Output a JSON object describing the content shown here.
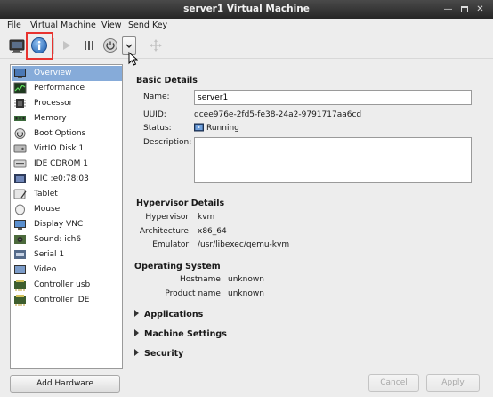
{
  "window": {
    "title": "server1 Virtual Machine"
  },
  "menubar": {
    "file": "File",
    "virtual_machine": "Virtual Machine",
    "view": "View",
    "send_key": "Send Key"
  },
  "toolbar": {
    "buttons": [
      "console-icon",
      "info-icon",
      "run-icon",
      "pause-icon",
      "power-icon",
      "chevron-down-icon",
      "fullscreen-icon"
    ]
  },
  "sidebar": {
    "items": [
      {
        "label": "Overview",
        "icon": "overview-icon",
        "selected": true
      },
      {
        "label": "Performance",
        "icon": "performance-icon"
      },
      {
        "label": "Processor",
        "icon": "processor-icon"
      },
      {
        "label": "Memory",
        "icon": "memory-icon"
      },
      {
        "label": "Boot Options",
        "icon": "boot-options-icon"
      },
      {
        "label": "VirtIO Disk 1",
        "icon": "disk-icon"
      },
      {
        "label": "IDE CDROM 1",
        "icon": "cdrom-icon"
      },
      {
        "label": "NIC :e0:78:03",
        "icon": "nic-icon"
      },
      {
        "label": "Tablet",
        "icon": "tablet-icon"
      },
      {
        "label": "Mouse",
        "icon": "mouse-icon"
      },
      {
        "label": "Display VNC",
        "icon": "display-icon"
      },
      {
        "label": "Sound: ich6",
        "icon": "sound-icon"
      },
      {
        "label": "Serial 1",
        "icon": "serial-icon"
      },
      {
        "label": "Video",
        "icon": "video-icon"
      },
      {
        "label": "Controller usb",
        "icon": "controller-icon"
      },
      {
        "label": "Controller IDE",
        "icon": "controller-icon"
      }
    ],
    "add_hardware": "Add Hardware"
  },
  "basic_details": {
    "heading": "Basic Details",
    "name_label": "Name:",
    "name_value": "server1",
    "uuid_label": "UUID:",
    "uuid_value": "dcee976e-2fd5-fe38-24a2-9791717aa6cd",
    "status_label": "Status:",
    "status_value": "Running",
    "description_label": "Description:",
    "description_value": ""
  },
  "hypervisor": {
    "heading": "Hypervisor Details",
    "hypervisor_label": "Hypervisor:",
    "hypervisor_value": "kvm",
    "architecture_label": "Architecture:",
    "architecture_value": "x86_64",
    "emulator_label": "Emulator:",
    "emulator_value": "/usr/libexec/qemu-kvm"
  },
  "os": {
    "heading": "Operating System",
    "hostname_label": "Hostname:",
    "hostname_value": "unknown",
    "product_label": "Product name:",
    "product_value": "unknown"
  },
  "expanders": {
    "applications": "Applications",
    "machine_settings": "Machine Settings",
    "security": "Security"
  },
  "footer": {
    "cancel": "Cancel",
    "apply": "Apply"
  },
  "colors": {
    "selection": "#86abd9",
    "highlight_box": "#e8332f",
    "titlebar": "#333333"
  }
}
